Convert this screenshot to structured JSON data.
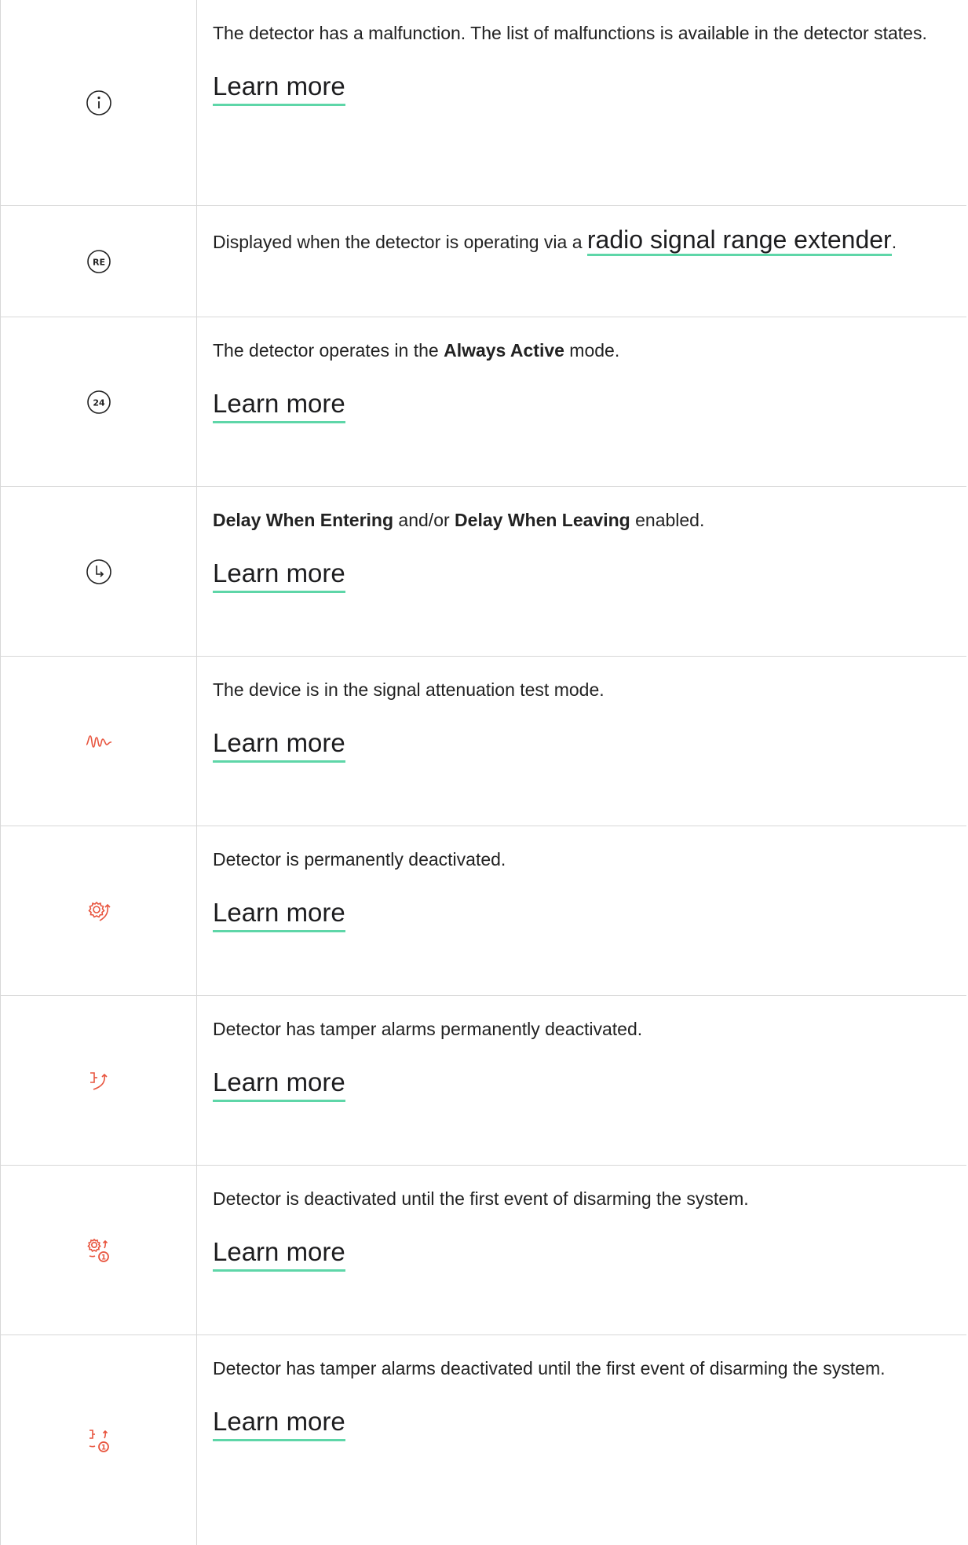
{
  "rows": [
    {
      "icon": "info-icon",
      "text": "The detector has a malfunction. The list of malfunctions is available in the detector states.",
      "link": "Learn more"
    },
    {
      "icon": "re-icon",
      "text_before": "Displayed when the detector is operating via a ",
      "link": "radio signal range extender",
      "text_after": "."
    },
    {
      "icon": "24-icon",
      "text_before": "The detector operates in the ",
      "bold": "Always Active",
      "text_after": " mode.",
      "link": "Learn more"
    },
    {
      "icon": "clock-delay-icon",
      "bold1": "Delay When Entering",
      "mid": " and/or ",
      "bold2": "Delay When Leaving",
      "text_after": " enabled.",
      "link": "Learn more"
    },
    {
      "icon": "signal-wave-icon",
      "text": "The device is in the signal attenuation test mode.",
      "link": "Learn more"
    },
    {
      "icon": "gear-deactivated-icon",
      "text": "Detector is permanently deactivated.",
      "link": "Learn more"
    },
    {
      "icon": "tamper-deactivated-icon",
      "text": "Detector has tamper alarms permanently deactivated.",
      "link": "Learn more"
    },
    {
      "icon": "gear-one-time-icon",
      "text": "Detector is deactivated until the first event of disarming the system.",
      "link": "Learn more"
    },
    {
      "icon": "tamper-one-time-icon",
      "text": "Detector has tamper alarms deactivated until the first event of disarming the system.",
      "link": "Learn more"
    }
  ],
  "colors": {
    "accent_underline": "#5ed6a8",
    "alert_icon": "#e8553f",
    "border": "#d8d8d8"
  }
}
